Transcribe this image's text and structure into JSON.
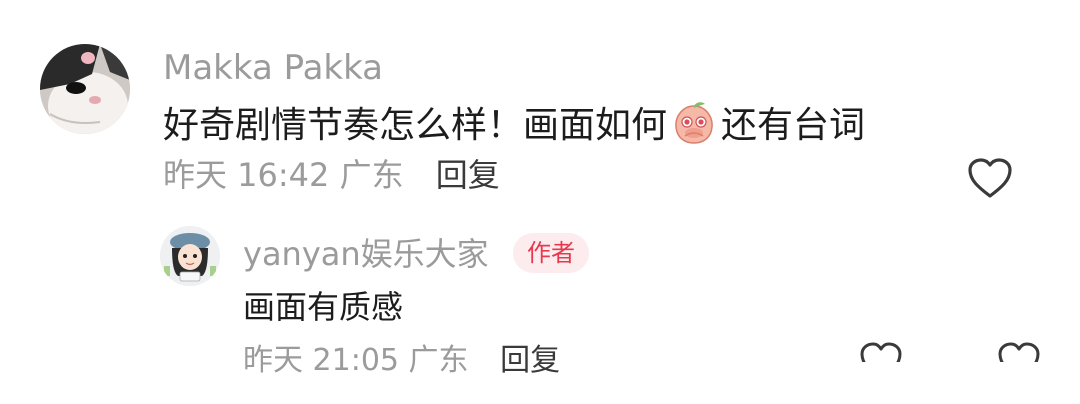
{
  "comment": {
    "author": "Makka Pakka",
    "text_before_emoji": "好奇剧情节奏怎么样！画面如何",
    "emoji": "peach-shy-icon",
    "text_after_emoji": "还有台词",
    "time": "昨天 16:42",
    "location": "广东",
    "reply_label": "回复",
    "like_icon": "heart-outline-icon"
  },
  "reply": {
    "author": "yanyan娱乐大家",
    "badge": "作者",
    "text": "画面有质感",
    "time": "昨天 21:05",
    "location": "广东",
    "reply_label": "回复"
  },
  "colors": {
    "text_primary": "#1c1c1c",
    "text_secondary": "#9b9b9b",
    "badge_bg": "#fdecee",
    "badge_text": "#e8384f"
  }
}
